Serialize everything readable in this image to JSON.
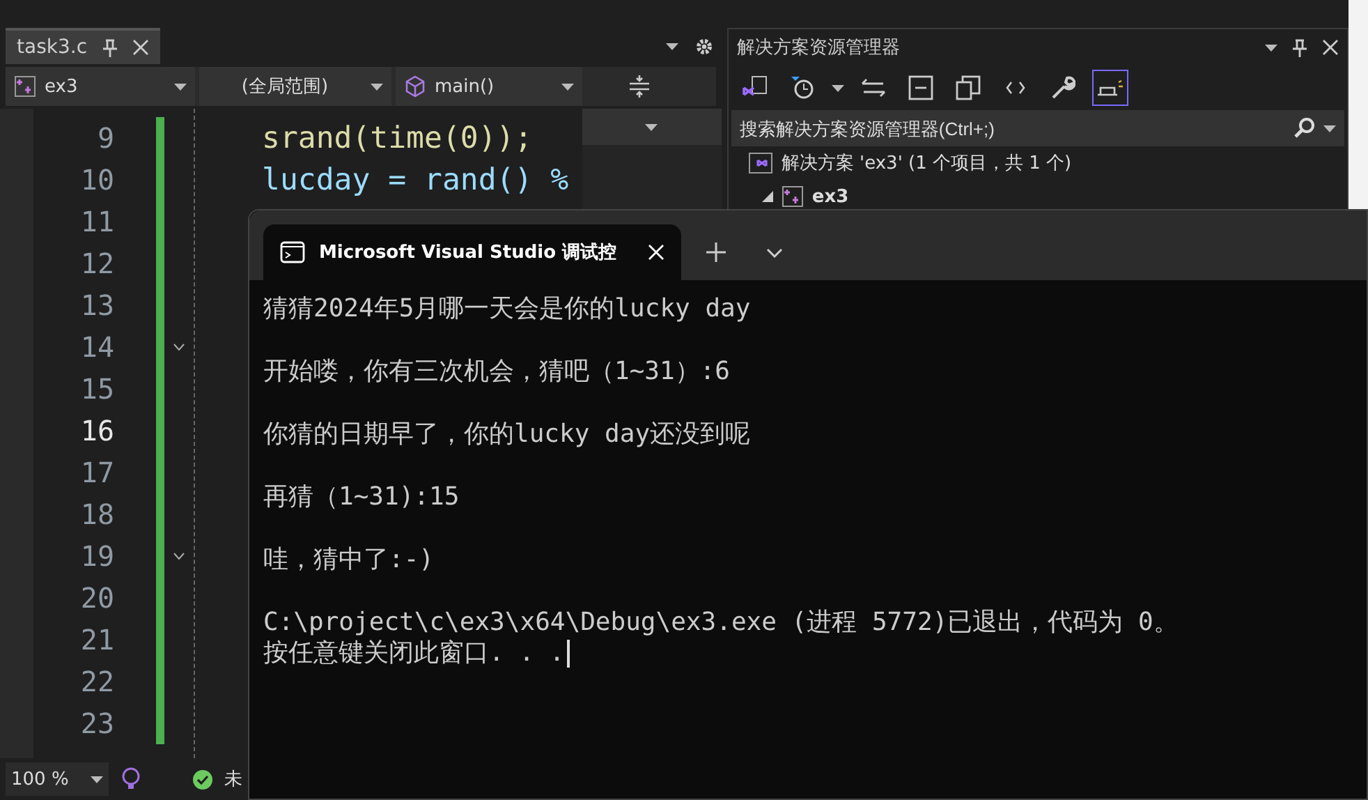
{
  "editor": {
    "tab": {
      "title": "task3.c",
      "selected": true
    },
    "nav": {
      "project": "ex3",
      "scope": "(全局范围)",
      "member": "main()"
    },
    "lines": [
      {
        "number": "9",
        "code": "srand(time(0));",
        "current": false,
        "fold": false
      },
      {
        "number": "10",
        "code": "lucday = rand() %",
        "current": false,
        "fold": false
      },
      {
        "number": "11",
        "current": false,
        "fold": false
      },
      {
        "number": "12",
        "current": false,
        "fold": false
      },
      {
        "number": "13",
        "current": false,
        "fold": false
      },
      {
        "number": "14",
        "current": false,
        "fold": true
      },
      {
        "number": "15",
        "current": false,
        "fold": false
      },
      {
        "number": "16",
        "current": true,
        "fold": false
      },
      {
        "number": "17",
        "current": false,
        "fold": false
      },
      {
        "number": "18",
        "current": false,
        "fold": false
      },
      {
        "number": "19",
        "current": false,
        "fold": true
      },
      {
        "number": "20",
        "current": false,
        "fold": false
      },
      {
        "number": "21",
        "current": false,
        "fold": false
      },
      {
        "number": "22",
        "current": false,
        "fold": false
      },
      {
        "number": "23",
        "current": false,
        "fold": false
      }
    ],
    "status": {
      "zoom": "100 %",
      "issues": "未"
    }
  },
  "solution_explorer": {
    "title": "解决方案资源管理器",
    "search": {
      "placeholder": "搜索解决方案资源管理器(Ctrl+;)"
    },
    "tree": [
      {
        "label": "解决方案 'ex3' (1 个项目，共 1 个)",
        "kind": "solution",
        "children": [
          {
            "label": "ex3",
            "kind": "project",
            "expanded": true
          }
        ]
      }
    ]
  },
  "console": {
    "tab_title": "Microsoft Visual Studio 调试控",
    "cursor": true,
    "blocks": [
      [
        "猜猜2024年5月哪一天会是你的lucky day"
      ],
      [
        "开始喽，你有三次机会，猜吧（1~31）:6"
      ],
      [
        "你猜的日期早了，你的lucky day还没到呢"
      ],
      [
        "再猜（1~31):15"
      ],
      [
        "哇，猜中了:-)"
      ],
      [
        "C:\\project\\c\\ex3\\x64\\Debug\\ex3.exe (进程 5772)已退出，代码为 0。",
        "按任意键关闭此窗口. . ."
      ]
    ]
  }
}
